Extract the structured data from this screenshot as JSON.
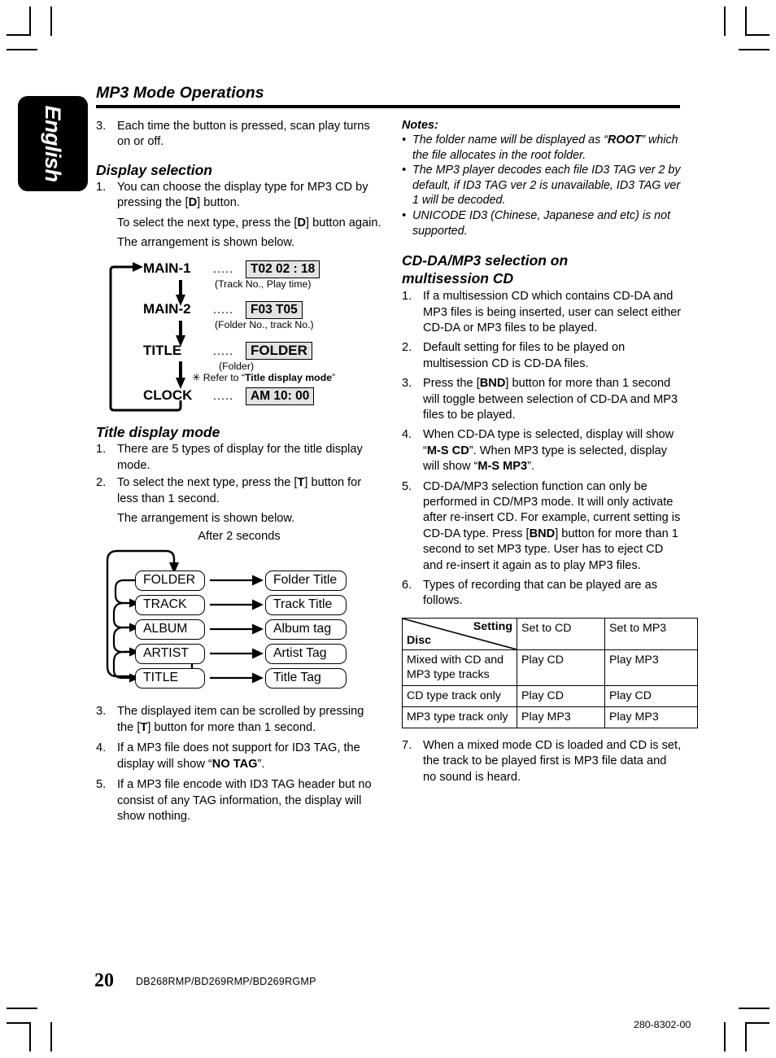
{
  "page": {
    "language_tab": "English",
    "title": "MP3 Mode Operations",
    "page_number": "20",
    "model_numbers": "DB268RMP/BD269RMP/BD269RGMP",
    "doc_code": "280-8302-00"
  },
  "left_column": {
    "item3_scan": {
      "num": "3.",
      "text": "Each time the button is pressed, scan play turns on or off."
    },
    "display_selection": {
      "heading": "Display selection",
      "item1_num": "1.",
      "item1_text_a": "You can choose the display type for MP3 CD by pressing the [",
      "item1_bold": "D",
      "item1_text_b": "] button.",
      "item1_para2_a": "To select the next type, press the [",
      "item1_para2_bold": "D",
      "item1_para2_b": "] button again.",
      "item1_para3": "The arrangement is shown below."
    },
    "display_flow": {
      "rows": [
        {
          "label": "MAIN-1",
          "dots": ".....",
          "value": "T02 02 : 18",
          "caption": "(Track No., Play time)"
        },
        {
          "label": "MAIN-2",
          "dots": ".....",
          "value": "F03 T05",
          "caption": "(Folder No., track No.)"
        },
        {
          "label": "TITLE",
          "dots": ".....",
          "value": "FOLDER",
          "caption": "(Folder)"
        },
        {
          "label": "CLOCK",
          "dots": ".....",
          "value": "AM 10: 00",
          "caption": ""
        }
      ],
      "refer_prefix": "✳ Refer to “",
      "refer_bold": "Title display mode",
      "refer_suffix": "”"
    },
    "title_display_mode": {
      "heading": "Title display mode",
      "item1_num": "1.",
      "item1_text": "There are 5 types of display for the title display mode.",
      "item2_num": "2.",
      "item2_text_a": "To select the next type, press the [",
      "item2_bold": "T",
      "item2_text_b": "] button for less than 1 second.",
      "item2_para2": "The arrangement is shown below.",
      "item3_num": "3.",
      "item3_text_a": "The displayed item can be scrolled by pressing the [",
      "item3_bold": "T",
      "item3_text_b": "] button for more than 1 second.",
      "item4_num": "4.",
      "item4_text_a": "If a MP3 file does not support for ID3 TAG, the display will show “",
      "item4_bold": "NO TAG",
      "item4_text_b": "”.",
      "item5_num": "5.",
      "item5_text": "If a MP3 file encode with ID3 TAG header but no consist of any TAG information, the display will show nothing."
    },
    "title_flow": {
      "after_label": "After 2 seconds",
      "modes": [
        "FOLDER",
        "TRACK",
        "ALBUM",
        "ARTIST",
        "TITLE"
      ],
      "results": [
        "Folder Title",
        "Track Title",
        "Album tag",
        "Artist Tag",
        "Title Tag"
      ]
    }
  },
  "right_column": {
    "notes": {
      "heading": "Notes:",
      "items": [
        {
          "text_a": "The folder name will be displayed as “",
          "bold": "ROOT",
          "text_b": "” which the file allocates in the root folder."
        },
        {
          "text_a": "The MP3 player decodes each file ID3 TAG ver 2 by default, if ID3 TAG ver 2 is unavailable, ID3 TAG ver 1 will be decoded.",
          "bold": "",
          "text_b": ""
        },
        {
          "text_a": "UNICODE ID3 (Chinese, Japanese and etc) is not supported.",
          "bold": "",
          "text_b": ""
        }
      ]
    },
    "cdda_section": {
      "heading_line1": "CD-DA/MP3 selection on",
      "heading_line2": "multisession CD",
      "item1_num": "1.",
      "item1_text": "If a multisession CD which contains CD-DA and MP3 files is being inserted, user can select either CD-DA or MP3 files to be played.",
      "item2_num": "2.",
      "item2_text": "Default setting for files to be played on multisession CD is CD-DA files.",
      "item3_num": "3.",
      "item3_text_a": "Press the [",
      "item3_bold": "BND",
      "item3_text_b": "] button for more than 1 second will toggle between selection of CD-DA and MP3 files to be played.",
      "item4_num": "4.",
      "item4_text_a": "When CD-DA type is selected, display will show “",
      "item4_bold1": "M-S CD",
      "item4_text_b": "”. When MP3 type is selected, display will show “",
      "item4_bold2": "M-S MP3",
      "item4_text_c": "”.",
      "item5_num": "5.",
      "item5_text_a": "CD-DA/MP3 selection function can only be performed in CD/MP3 mode. It will only activate after re-insert CD. For example, current setting is CD-DA type. Press [",
      "item5_bold": "BND",
      "item5_text_b": "] button for more than 1 second to set MP3 type. User has to eject CD and re-insert it again as to play MP3 files.",
      "item6_num": "6.",
      "item6_text": "Types of recording that can be played are as follows.",
      "item7_num": "7.",
      "item7_text": "When a mixed mode CD is loaded and CD is set, the track to be played first is MP3 file data and no sound is heard."
    },
    "recording_table": {
      "corner_setting": "Setting",
      "corner_disc": "Disc",
      "columns": [
        "Set to CD",
        "Set to MP3"
      ],
      "rows": [
        {
          "disc": "Mixed with CD and MP3 type tracks",
          "set_to_cd": "Play CD",
          "set_to_mp3": "Play MP3"
        },
        {
          "disc": "CD type track only",
          "set_to_cd": "Play CD",
          "set_to_mp3": "Play CD"
        },
        {
          "disc": "MP3 type track only",
          "set_to_cd": "Play MP3",
          "set_to_mp3": "Play MP3"
        }
      ]
    }
  }
}
